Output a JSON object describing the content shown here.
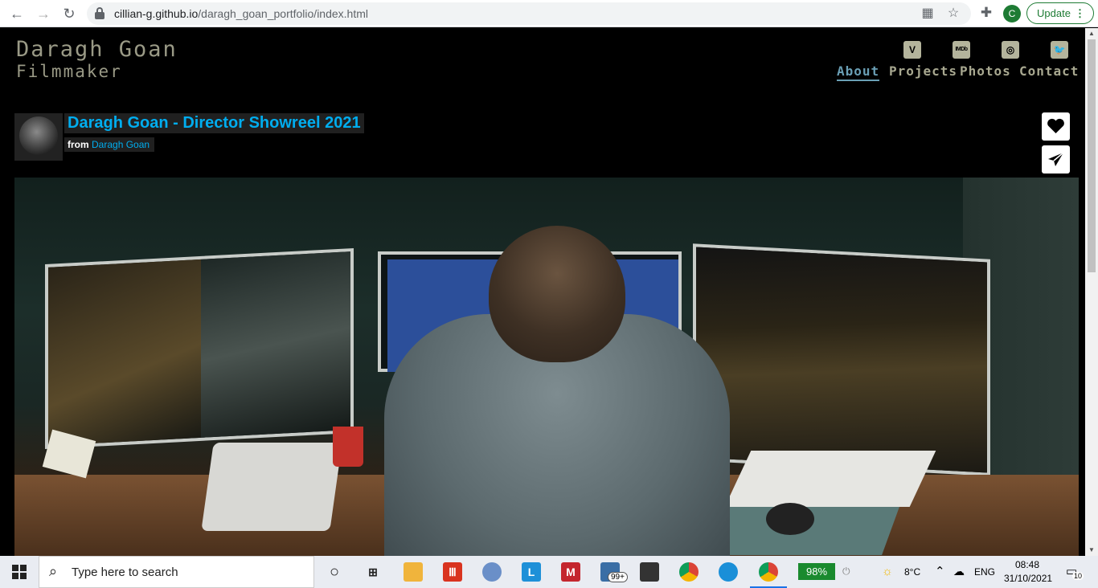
{
  "browser": {
    "url_host": "cillian-g.github.io",
    "url_path": "/daragh_goan_portfolio/index.html",
    "update_label": "Update",
    "profile_initial": "C"
  },
  "site": {
    "brand_name": "Daragh Goan",
    "brand_tagline": "Filmmaker",
    "social": [
      {
        "icon": "vimeo-icon",
        "glyph": "V"
      },
      {
        "icon": "imdb-icon",
        "glyph": "IMDb"
      },
      {
        "icon": "instagram-icon",
        "glyph": "◎"
      },
      {
        "icon": "twitter-icon",
        "glyph": "🐦"
      }
    ],
    "nav": [
      {
        "label": "About",
        "active": true
      },
      {
        "label": "Projects",
        "active": false
      },
      {
        "label": "Photos",
        "active": false
      },
      {
        "label": "Contact",
        "active": false
      }
    ]
  },
  "video": {
    "title": "Daragh Goan - Director Showreel 2021",
    "from_label": "from",
    "author": "Daragh Goan"
  },
  "taskbar": {
    "search_placeholder": "Type here to search",
    "mail_badge": "99+",
    "battery": "98%",
    "weather": "8°C",
    "language": "ENG",
    "time": "08:48",
    "date": "31/10/2021",
    "notifications": "10"
  },
  "colors": {
    "accent": "#00adef",
    "nav_active": "#6a9fb5",
    "nav_text": "#a8a890",
    "brand_text": "#9a9a86"
  }
}
